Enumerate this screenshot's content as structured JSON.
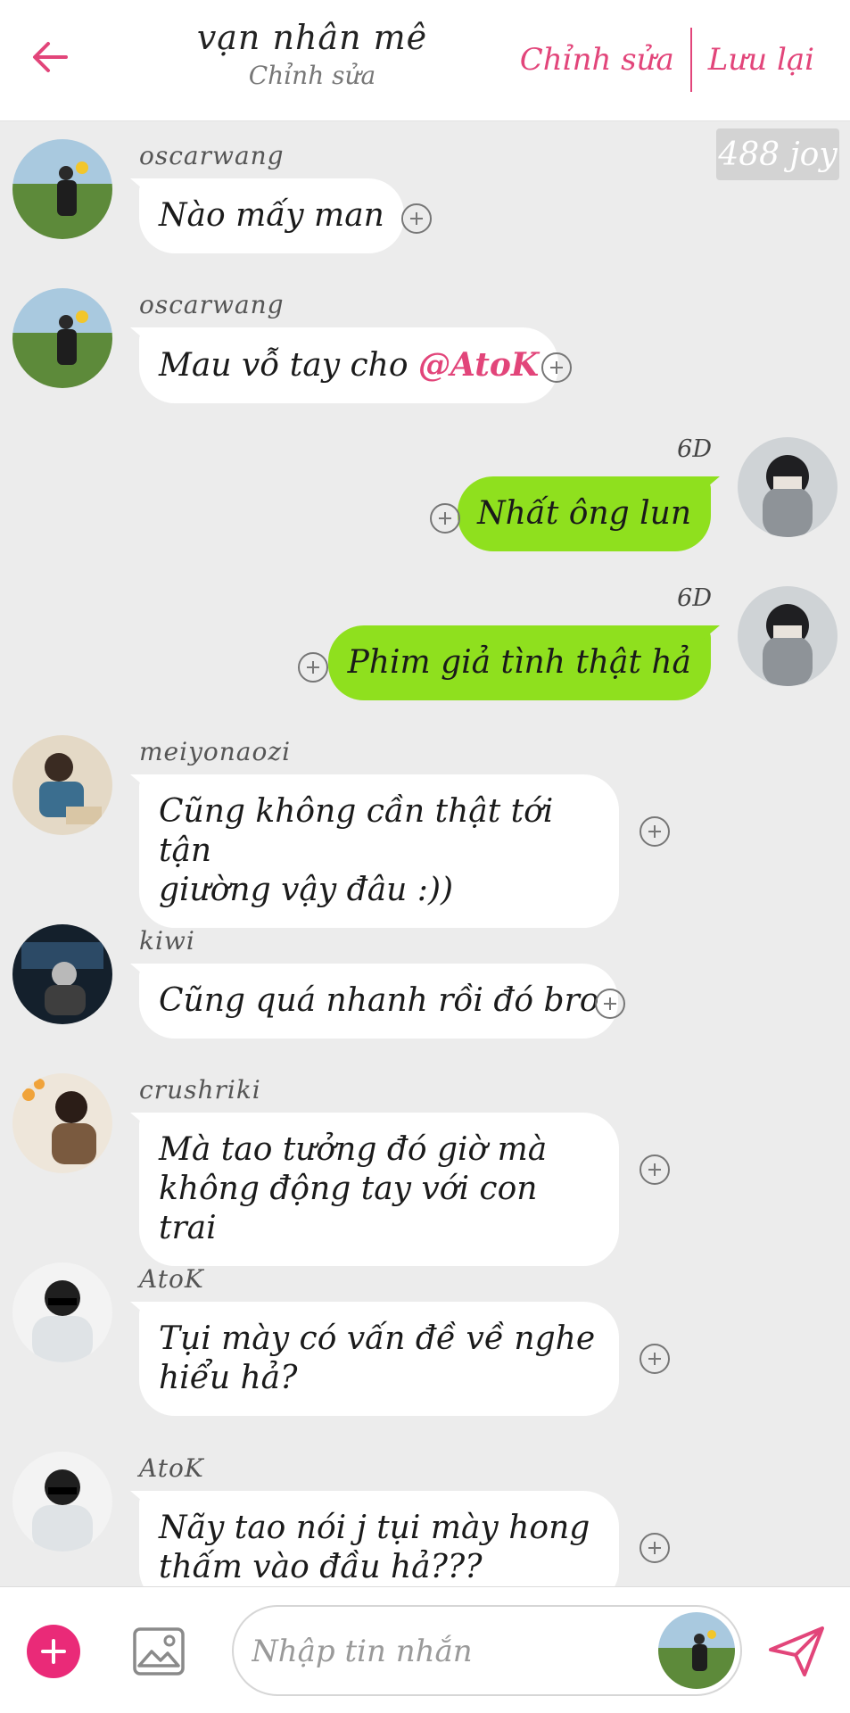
{
  "header": {
    "title": "vạn nhân mê",
    "subtitle": "Chỉnh sửa",
    "edit_label": "Chỉnh sửa",
    "save_label": "Lưu lại"
  },
  "watermark": "488 joy",
  "colors": {
    "accent": "#e2457a",
    "outgoing_bubble": "#8fe01e",
    "incoming_bubble": "#ffffff",
    "background": "#ececec"
  },
  "messages": [
    {
      "direction": "in",
      "sender": "oscarwang",
      "text": "Nào mấy man"
    },
    {
      "direction": "in",
      "sender": "oscarwang",
      "text_before": "Mau vỗ tay cho ",
      "mention": "@AtoK"
    },
    {
      "direction": "out",
      "time": "6D",
      "text": "Nhất ông lun"
    },
    {
      "direction": "out",
      "time": "6D",
      "text": "Phim giả tình thật hả"
    },
    {
      "direction": "in",
      "sender": "meiyonaozi",
      "line1": "Cũng không cần thật tới tận",
      "line2": "giường vậy đâu :))"
    },
    {
      "direction": "in",
      "sender": "kiwi",
      "text": "Cũng quá nhanh rồi đó bro"
    },
    {
      "direction": "in",
      "sender": "crushriki",
      "line1": "Mà tao tưởng đó giờ mà",
      "line2": "không động tay với con trai"
    },
    {
      "direction": "in",
      "sender": "AtoK",
      "line1": "Tụi mày có vấn đề về nghe",
      "line2": "hiểu hả?"
    },
    {
      "direction": "in",
      "sender": "AtoK",
      "line1": "Nãy tao nói j tụi mày hong",
      "line2": "thấm vào đầu hả???"
    }
  ],
  "composer": {
    "placeholder": "Nhập tin nhắn"
  },
  "icons": [
    "back-arrow-icon",
    "plus-circle-icon",
    "add-icon",
    "image-icon",
    "send-icon"
  ]
}
